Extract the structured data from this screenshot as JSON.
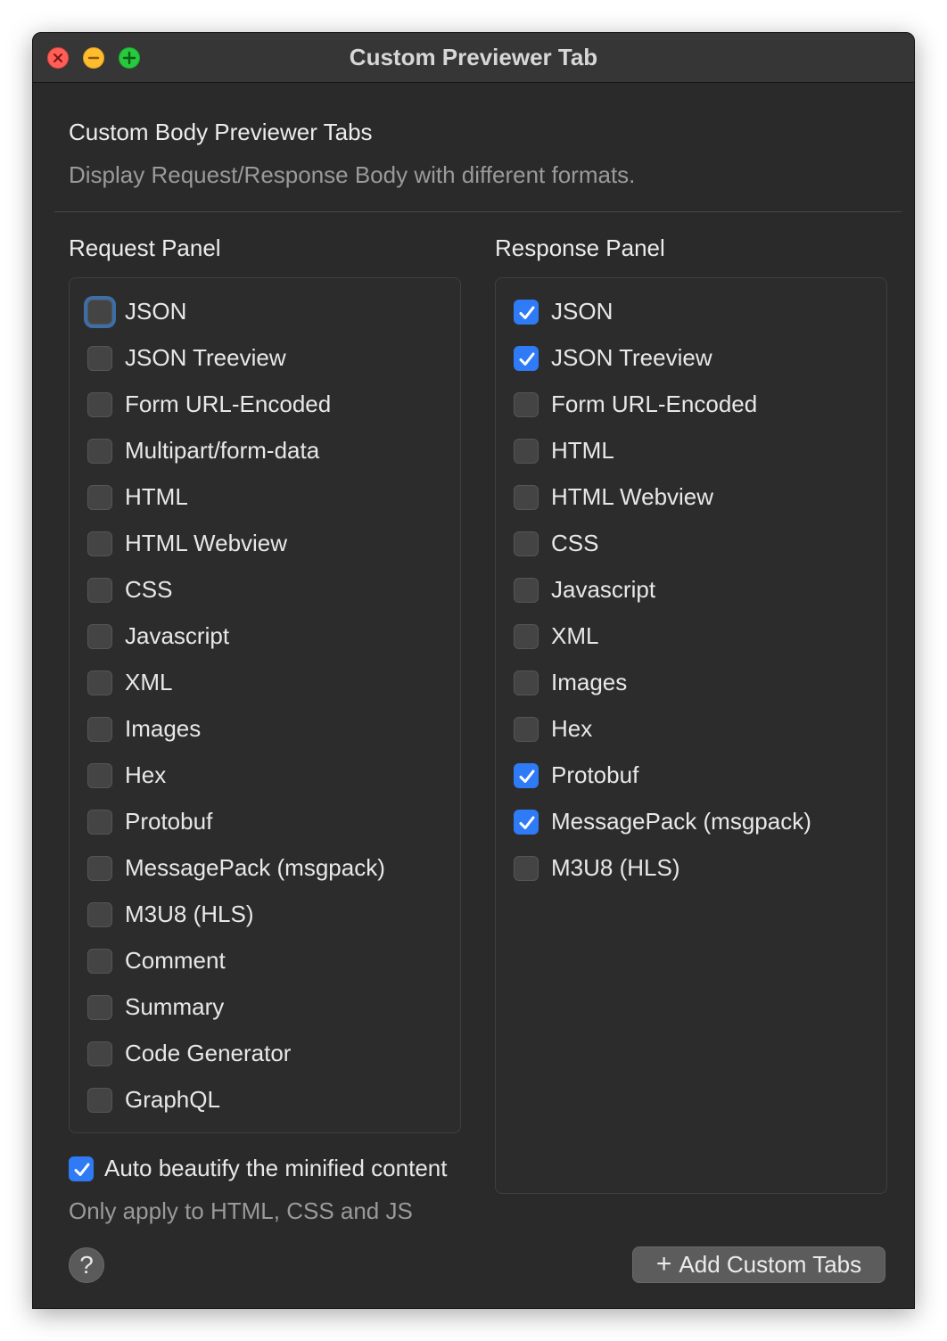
{
  "window": {
    "title": "Custom Previewer Tab"
  },
  "header": {
    "title": "Custom Body Previewer Tabs",
    "subtitle": "Display Request/Response Body with different formats."
  },
  "request_panel": {
    "label": "Request Panel",
    "items": [
      {
        "label": "JSON",
        "checked": false,
        "focused": true
      },
      {
        "label": "JSON Treeview",
        "checked": false
      },
      {
        "label": "Form URL-Encoded",
        "checked": false
      },
      {
        "label": "Multipart/form-data",
        "checked": false
      },
      {
        "label": "HTML",
        "checked": false
      },
      {
        "label": "HTML Webview",
        "checked": false
      },
      {
        "label": "CSS",
        "checked": false
      },
      {
        "label": "Javascript",
        "checked": false
      },
      {
        "label": "XML",
        "checked": false
      },
      {
        "label": "Images",
        "checked": false
      },
      {
        "label": "Hex",
        "checked": false
      },
      {
        "label": "Protobuf",
        "checked": false
      },
      {
        "label": "MessagePack (msgpack)",
        "checked": false
      },
      {
        "label": "M3U8 (HLS)",
        "checked": false
      },
      {
        "label": "Comment",
        "checked": false
      },
      {
        "label": "Summary",
        "checked": false
      },
      {
        "label": "Code Generator",
        "checked": false
      },
      {
        "label": "GraphQL",
        "checked": false
      }
    ]
  },
  "response_panel": {
    "label": "Response Panel",
    "items": [
      {
        "label": "JSON",
        "checked": true
      },
      {
        "label": "JSON Treeview",
        "checked": true
      },
      {
        "label": "Form URL-Encoded",
        "checked": false
      },
      {
        "label": "HTML",
        "checked": false
      },
      {
        "label": "HTML Webview",
        "checked": false
      },
      {
        "label": "CSS",
        "checked": false
      },
      {
        "label": "Javascript",
        "checked": false
      },
      {
        "label": "XML",
        "checked": false
      },
      {
        "label": "Images",
        "checked": false
      },
      {
        "label": "Hex",
        "checked": false
      },
      {
        "label": "Protobuf",
        "checked": true
      },
      {
        "label": "MessagePack (msgpack)",
        "checked": true
      },
      {
        "label": "M3U8 (HLS)",
        "checked": false
      }
    ]
  },
  "beautify": {
    "label": "Auto beautify the minified content",
    "checked": true,
    "note": "Only apply to HTML, CSS and JS"
  },
  "footer": {
    "help_label": "?",
    "add_button_label": "Add Custom Tabs",
    "add_icon": "+"
  },
  "colors": {
    "accent": "#2f7bf6",
    "window_bg": "#2a2a2a"
  }
}
